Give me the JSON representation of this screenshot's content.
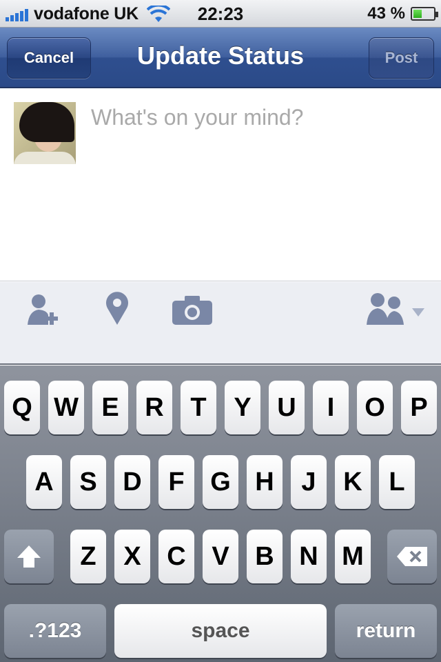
{
  "status_bar": {
    "carrier": "vodafone UK",
    "time": "22:23",
    "battery_text": "43 %",
    "battery_level": 0.43,
    "signal_icon": "signal-bars-icon",
    "wifi_icon": "wifi-icon",
    "battery_icon": "battery-icon"
  },
  "nav": {
    "title": "Update Status",
    "cancel_label": "Cancel",
    "post_label": "Post"
  },
  "compose": {
    "placeholder": "What's on your mind?",
    "avatar": "profile-photo"
  },
  "toolbar": {
    "icons": [
      "tag-friends-icon",
      "location-pin-icon",
      "camera-icon",
      "audience-friends-icon"
    ]
  },
  "keyboard": {
    "row1": [
      "Q",
      "W",
      "E",
      "R",
      "T",
      "Y",
      "U",
      "I",
      "O",
      "P"
    ],
    "row2": [
      "A",
      "S",
      "D",
      "F",
      "G",
      "H",
      "J",
      "K",
      "L"
    ],
    "row3": [
      "Z",
      "X",
      "C",
      "V",
      "B",
      "N",
      "M"
    ],
    "numbers_label": ".?123",
    "space_label": "space",
    "return_label": "return",
    "shift_icon": "shift-arrow-icon",
    "delete_icon": "backspace-icon"
  },
  "colors": {
    "nav_blue": "#3f5f9e",
    "placeholder_gray": "#a9a9a9",
    "toolbar_icon": "#7a87a6"
  }
}
